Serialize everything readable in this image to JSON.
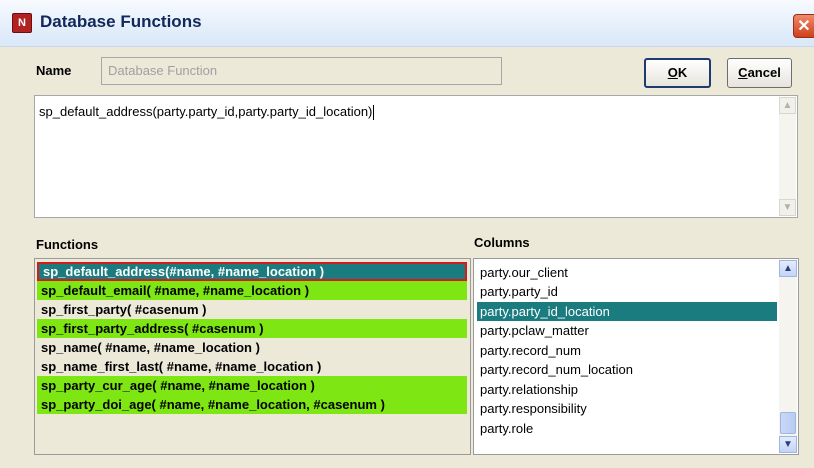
{
  "window": {
    "title": "Database Functions",
    "app_icon": "database-app-icon",
    "close_icon": "close-icon"
  },
  "name_field": {
    "label": "Name",
    "placeholder": "Database Function",
    "value": ""
  },
  "buttons": {
    "ok_prefix": "",
    "ok_underlined": "O",
    "ok_rest": "K",
    "cancel_underlined": "C",
    "cancel_rest": "ancel"
  },
  "expression": {
    "value": "sp_default_address(party.party_id,party.party_id_location)"
  },
  "functions": {
    "label": "Functions",
    "items": [
      {
        "text": "sp_default_address(#name, #name_location )",
        "style": "selected"
      },
      {
        "text": "sp_default_email( #name, #name_location )",
        "style": "green"
      },
      {
        "text": "sp_first_party( #casenum )",
        "style": "plain"
      },
      {
        "text": "sp_first_party_address( #casenum )",
        "style": "green"
      },
      {
        "text": "sp_name( #name, #name_location )",
        "style": "plain"
      },
      {
        "text": "sp_name_first_last( #name, #name_location )",
        "style": "plain"
      },
      {
        "text": "sp_party_cur_age( #name, #name_location )",
        "style": "green"
      },
      {
        "text": "sp_party_doi_age( #name, #name_location, #casenum )",
        "style": "green"
      }
    ]
  },
  "columns": {
    "label": "Columns",
    "items": [
      "party.our_client",
      "party.party_id",
      "party.party_id_location",
      "party.pclaw_matter",
      "party.record_num",
      "party.record_num_location",
      "party.relationship",
      "party.responsibility",
      "party.role"
    ],
    "selected": "party.party_id_location",
    "scroll_up_icon": "scroll-up-arrow-icon",
    "scroll_down_icon": "scroll-down-arrow-icon"
  },
  "colors": {
    "selection": "#1b7c80",
    "highlight_green": "#7de613",
    "selected_border": "#d51c1c"
  }
}
